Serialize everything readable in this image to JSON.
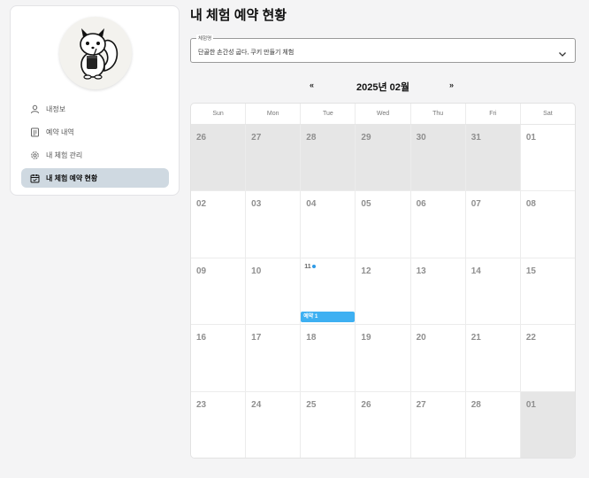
{
  "sidebar": {
    "items": [
      {
        "label": "내정보",
        "icon": "user-icon",
        "active": false
      },
      {
        "label": "예약 내역",
        "icon": "document-list-icon",
        "active": false
      },
      {
        "label": "내 체험 관리",
        "icon": "gear-icon",
        "active": false
      },
      {
        "label": "내 체험 예약 현황",
        "icon": "calendar-check-icon",
        "active": true
      }
    ]
  },
  "main": {
    "title": "내 체험 예약 현황",
    "select": {
      "legend": "체험명",
      "value": "단골한 손간성 굽다, 쿠키 만들기 체험"
    },
    "calendar": {
      "prev": "«",
      "next": "»",
      "month_label": "2025년 02월",
      "weekdays": [
        "Sun",
        "Mon",
        "Tue",
        "Wed",
        "Thu",
        "Fri",
        "Sat"
      ],
      "weeks": [
        [
          {
            "n": "26",
            "other": true
          },
          {
            "n": "27",
            "other": true
          },
          {
            "n": "28",
            "other": true
          },
          {
            "n": "29",
            "other": true
          },
          {
            "n": "30",
            "other": true
          },
          {
            "n": "31",
            "other": true
          },
          {
            "n": "01",
            "other": false
          }
        ],
        [
          {
            "n": "02"
          },
          {
            "n": "03"
          },
          {
            "n": "04"
          },
          {
            "n": "05"
          },
          {
            "n": "06"
          },
          {
            "n": "07"
          },
          {
            "n": "08"
          }
        ],
        [
          {
            "n": "09"
          },
          {
            "n": "10"
          },
          {
            "n": "11",
            "dot": true,
            "event": "예약 1"
          },
          {
            "n": "12"
          },
          {
            "n": "13"
          },
          {
            "n": "14"
          },
          {
            "n": "15"
          }
        ],
        [
          {
            "n": "16"
          },
          {
            "n": "17"
          },
          {
            "n": "18"
          },
          {
            "n": "19"
          },
          {
            "n": "20"
          },
          {
            "n": "21"
          },
          {
            "n": "22"
          }
        ],
        [
          {
            "n": "23"
          },
          {
            "n": "24"
          },
          {
            "n": "25"
          },
          {
            "n": "26"
          },
          {
            "n": "27"
          },
          {
            "n": "28"
          },
          {
            "n": "01",
            "other": true
          }
        ]
      ]
    }
  },
  "colors": {
    "active_nav": "#cfd9e1",
    "event": "#3eb0f2",
    "other_month": "#e6e6e6"
  }
}
